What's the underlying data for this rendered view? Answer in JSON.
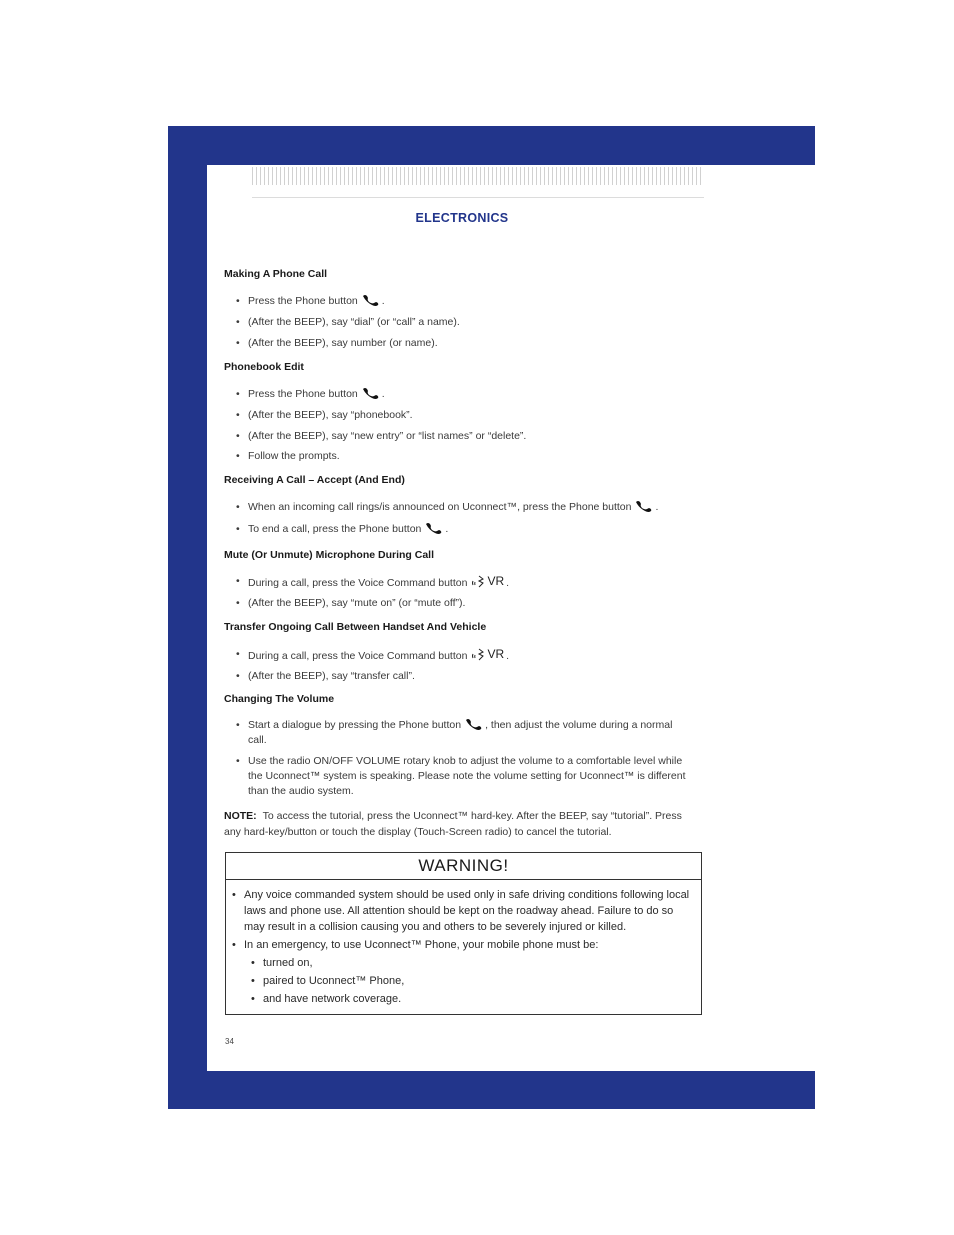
{
  "header": {
    "section_title": "ELECTRONICS"
  },
  "sections": [
    {
      "heading": "Making A Phone Call",
      "items": [
        {
          "text": "Press the Phone button",
          "icon": "phone-icon",
          "after": "."
        },
        {
          "text": "(After the BEEP), say “dial” (or “call” a name)."
        },
        {
          "text": "(After the BEEP), say number (or name)."
        }
      ]
    },
    {
      "heading": "Phonebook Edit",
      "items": [
        {
          "text": "Press the Phone button",
          "icon": "phone-icon",
          "after": "."
        },
        {
          "text": "(After the BEEP), say “phonebook”."
        },
        {
          "text": "(After the BEEP), say “new entry” or “list names” or “delete”."
        },
        {
          "text": "Follow the prompts."
        }
      ]
    },
    {
      "heading": "Receiving A Call – Accept (And End)",
      "items": [
        {
          "text": "When an incoming call rings/is announced on Uconnect™, press the Phone button",
          "icon": "phone-icon",
          "after": "."
        },
        {
          "text": "To end a call, press the Phone button",
          "icon": "phone-icon",
          "after": "."
        }
      ]
    },
    {
      "heading": "Mute (Or Unmute) Microphone During Call",
      "items": [
        {
          "text": "During a call, press the Voice Command button",
          "icon": "voice-command-icon",
          "icon_label": "VR",
          "after": "."
        },
        {
          "text": "(After the BEEP), say “mute on” (or “mute off”)."
        }
      ]
    },
    {
      "heading": "Transfer Ongoing Call Between Handset And Vehicle",
      "items": [
        {
          "text": "During a call, press the Voice Command button",
          "icon": "voice-command-icon",
          "icon_label": "VR",
          "after": "."
        },
        {
          "text": "(After the BEEP), say “transfer call”."
        }
      ]
    },
    {
      "heading": "Changing The Volume",
      "items": [
        {
          "text": "Start a dialogue by pressing the Phone button",
          "icon": "phone-icon",
          "after": ", then adjust the volume during a normal call."
        },
        {
          "text": "Use the radio ON/OFF VOLUME rotary knob to adjust the volume to a comfortable level while the Uconnect™ system is speaking. Please note the volume setting for Uconnect™ is different than the audio system."
        }
      ]
    }
  ],
  "note": {
    "label": "NOTE:",
    "text": "To access the tutorial, press the Uconnect™ hard-key. After the BEEP, say “tutorial”. Press any hard-key/button or touch the display (Touch-Screen radio) to cancel the tutorial."
  },
  "warning": {
    "title": "WARNING!",
    "items": [
      "Any voice commanded system should be used only in safe driving conditions following local laws and phone use. All attention should be kept on the roadway ahead. Failure to do so may result in a collision causing you and others to be severely injured or killed.",
      "In an emergency, to use Uconnect™ Phone, your mobile phone must be:"
    ],
    "subitems": [
      "turned on,",
      "paired to Uconnect™ Phone,",
      "and have network coverage."
    ]
  },
  "footer": {
    "page_number": "34"
  },
  "colors": {
    "frame_blue": "#22358b",
    "title_blue": "#22358b"
  }
}
